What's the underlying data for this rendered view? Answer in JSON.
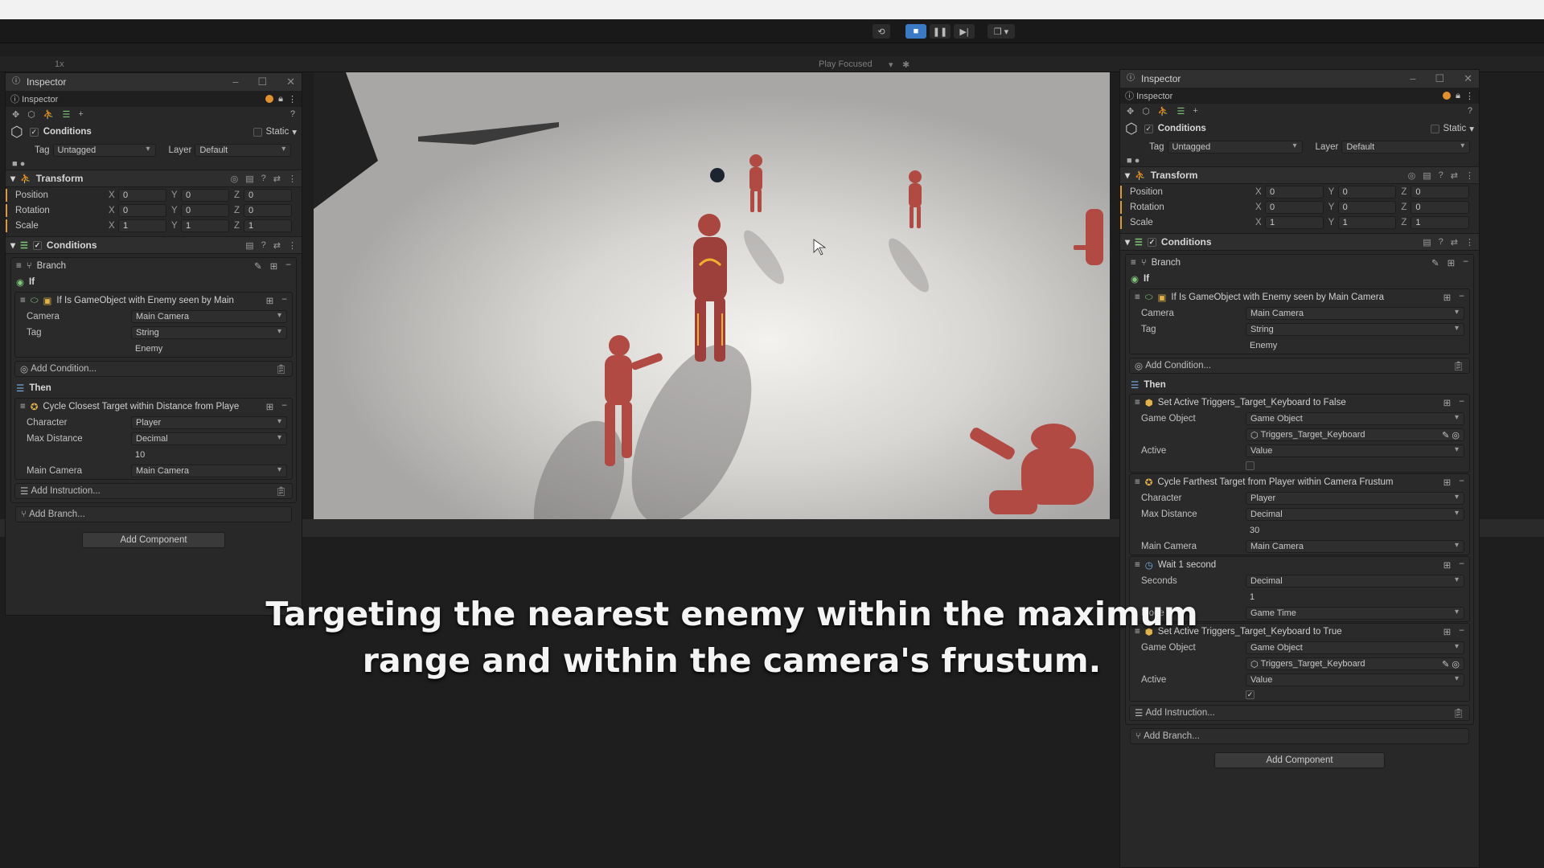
{
  "toolbar": {
    "playmode_speed": "1x",
    "play_focused": "Play Focused",
    "icons": [
      "restart-icon",
      "stop-icon",
      "pause-icon",
      "step-icon",
      "layout-icon"
    ]
  },
  "left_inspector": {
    "window_title": "Inspector",
    "tab_label": "Inspector",
    "object_name": "Conditions",
    "static_label": "Static",
    "tag_label": "Tag",
    "tag_value": "Untagged",
    "layer_label": "Layer",
    "layer_value": "Default",
    "transform": {
      "title": "Transform",
      "rows": [
        {
          "label": "Position",
          "x": "0",
          "y": "0",
          "z": "0"
        },
        {
          "label": "Rotation",
          "x": "0",
          "y": "0",
          "z": "0"
        },
        {
          "label": "Scale",
          "x": "1",
          "y": "1",
          "z": "1"
        }
      ]
    },
    "conditions_title": "Conditions",
    "branch_label": "Branch",
    "if_label": "If",
    "condition_title": "If Is GameObject with Enemy seen by Main",
    "condition_fields": {
      "camera_label": "Camera",
      "camera_value": "Main Camera",
      "tag_label": "Tag",
      "tag_value": "String",
      "tag_text": "Enemy"
    },
    "add_condition": "Add Condition...",
    "then_label": "Then",
    "instruction_title": "Cycle Closest Target within Distance from Playe",
    "instruction_fields": {
      "character_label": "Character",
      "character_value": "Player",
      "max_distance_label": "Max Distance",
      "max_distance_type": "Decimal",
      "max_distance_value": "10",
      "main_camera_label": "Main Camera",
      "main_camera_value": "Main Camera"
    },
    "add_instruction": "Add Instruction...",
    "add_branch": "Add Branch...",
    "add_component": "Add Component"
  },
  "right_inspector": {
    "window_title": "Inspector",
    "tab_label": "Inspector",
    "object_name": "Conditions",
    "static_label": "Static",
    "tag_label": "Tag",
    "tag_value": "Untagged",
    "layer_label": "Layer",
    "layer_value": "Default",
    "transform": {
      "title": "Transform",
      "rows": [
        {
          "label": "Position",
          "x": "0",
          "y": "0",
          "z": "0"
        },
        {
          "label": "Rotation",
          "x": "0",
          "y": "0",
          "z": "0"
        },
        {
          "label": "Scale",
          "x": "1",
          "y": "1",
          "z": "1"
        }
      ]
    },
    "conditions_title": "Conditions",
    "branch_label": "Branch",
    "if_label": "If",
    "condition_title": "If Is GameObject with Enemy seen by Main Camera",
    "condition_fields": {
      "camera_label": "Camera",
      "camera_value": "Main Camera",
      "tag_label": "Tag",
      "tag_value": "String",
      "tag_text": "Enemy"
    },
    "add_condition": "Add Condition...",
    "then_label": "Then",
    "instr1": {
      "title": "Set Active Triggers_Target_Keyboard to False",
      "game_object_label": "Game Object",
      "game_object_type": "Game Object",
      "game_object_value": "Triggers_Target_Keyboard",
      "active_label": "Active",
      "active_type": "Value"
    },
    "instr2": {
      "title": "Cycle Farthest Target from Player within Camera Frustum",
      "character_label": "Character",
      "character_value": "Player",
      "max_distance_label": "Max Distance",
      "max_distance_type": "Decimal",
      "max_distance_value": "30",
      "main_camera_label": "Main Camera",
      "main_camera_value": "Main Camera"
    },
    "instr3": {
      "title": "Wait 1 second",
      "seconds_label": "Seconds",
      "seconds_type": "Decimal",
      "seconds_value": "1",
      "mode_label": "Mode",
      "mode_value": "Game Time"
    },
    "instr4": {
      "title": "Set Active Triggers_Target_Keyboard to True",
      "game_object_label": "Game Object",
      "game_object_type": "Game Object",
      "game_object_value": "Triggers_Target_Keyboard",
      "active_label": "Active",
      "active_type": "Value",
      "active_checked": "✓"
    },
    "add_instruction": "Add Instruction...",
    "add_branch": "Add Branch...",
    "add_component": "Add Component"
  },
  "caption": {
    "line1": "Targeting the nearest enemy within the maximum",
    "line2": "range and within the camera's frustum."
  },
  "colors": {
    "accent_blue": "#3a79c4",
    "warning_orange": "#e0902e",
    "enemy_red": "#b24a44",
    "player_glow": "#f0b030"
  }
}
